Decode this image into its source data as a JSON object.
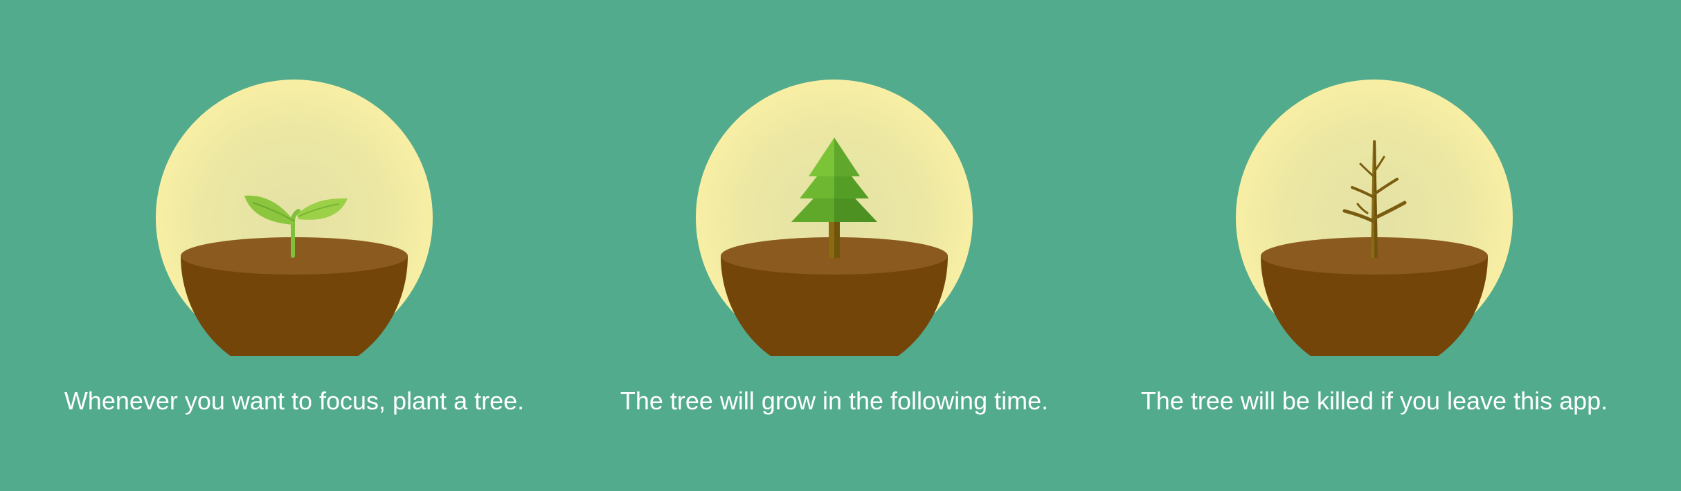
{
  "background_color": "#52AB8D",
  "steps": [
    {
      "icon": "sapling-icon",
      "caption": "Whenever you want to focus, plant a tree."
    },
    {
      "icon": "pine-tree-icon",
      "caption": "The tree will grow in the following time."
    },
    {
      "icon": "dead-tree-icon",
      "caption": "The tree will be killed if you leave this app."
    }
  ],
  "colors": {
    "globe": "#F8EFA4",
    "soil_top": "#8B5A1F",
    "soil_body": "#744509",
    "leaf": "#8CC63F",
    "pine": "#5FA82A",
    "trunk": "#8B6A12",
    "text": "#FFFFFF"
  }
}
